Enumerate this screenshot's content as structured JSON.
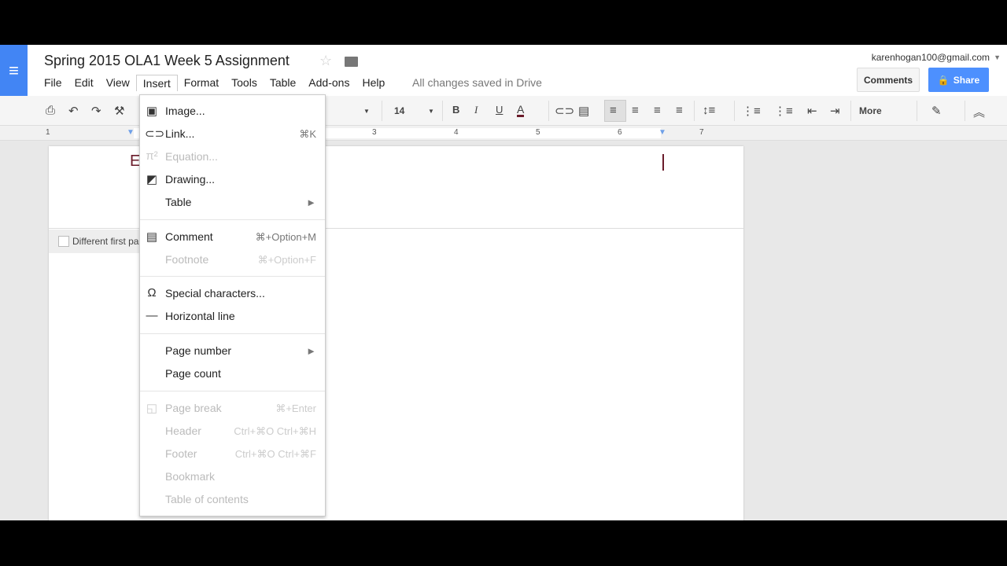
{
  "doc": {
    "title": "Spring 2015 OLA1 Week 5 Assignment",
    "status": "All changes saved in Drive",
    "partial_text": "E"
  },
  "menubar": [
    "File",
    "Edit",
    "View",
    "Insert",
    "Format",
    "Tools",
    "Table",
    "Add-ons",
    "Help"
  ],
  "account": {
    "email": "karenhogan100@gmail.com"
  },
  "buttons": {
    "comments": "Comments",
    "share": "Share"
  },
  "toolbar": {
    "font_size": "14",
    "more": "More"
  },
  "ruler": [
    "1",
    "3",
    "4",
    "5",
    "6",
    "7"
  ],
  "header_option": "Different first pa",
  "colors": {
    "brand": "#4285f4",
    "share": "#4d90fe",
    "text_color": "#6a1b2a"
  },
  "insert_menu": [
    {
      "label": "Image...",
      "shortcut": "",
      "icon": "image-icon",
      "disabled": false
    },
    {
      "label": "Link...",
      "shortcut": "⌘K",
      "icon": "link-icon",
      "disabled": false
    },
    {
      "label": "Equation...",
      "shortcut": "",
      "icon": "pi-icon",
      "disabled": true
    },
    {
      "label": "Drawing...",
      "shortcut": "",
      "icon": "drawing-icon",
      "disabled": false
    },
    {
      "label": "Table",
      "shortcut": "►",
      "icon": "",
      "disabled": false
    },
    {
      "label": "Comment",
      "shortcut": "⌘+Option+M",
      "icon": "comment-icon",
      "disabled": false
    },
    {
      "label": "Footnote",
      "shortcut": "⌘+Option+F",
      "icon": "",
      "disabled": true
    },
    {
      "label": "Special characters...",
      "shortcut": "",
      "icon": "omega-icon",
      "disabled": false
    },
    {
      "label": "Horizontal line",
      "shortcut": "",
      "icon": "horizontal-line-icon",
      "disabled": false
    },
    {
      "label": "Page number",
      "shortcut": "►",
      "icon": "",
      "disabled": false
    },
    {
      "label": "Page count",
      "shortcut": "",
      "icon": "",
      "disabled": false
    },
    {
      "label": "Page break",
      "shortcut": "⌘+Enter",
      "icon": "page-break-icon",
      "disabled": true
    },
    {
      "label": "Header",
      "shortcut": "Ctrl+⌘O Ctrl+⌘H",
      "icon": "",
      "disabled": true
    },
    {
      "label": "Footer",
      "shortcut": "Ctrl+⌘O Ctrl+⌘F",
      "icon": "",
      "disabled": true
    },
    {
      "label": "Bookmark",
      "shortcut": "",
      "icon": "",
      "disabled": true
    },
    {
      "label": "Table of contents",
      "shortcut": "",
      "icon": "",
      "disabled": true
    }
  ]
}
